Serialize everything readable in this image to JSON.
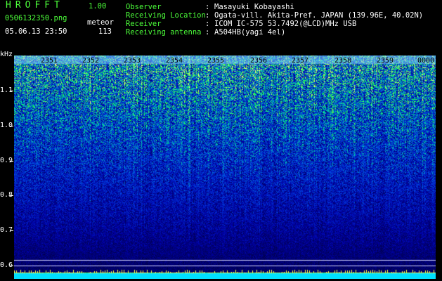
{
  "app": {
    "title": "HROFFT",
    "version": "1.00"
  },
  "file": {
    "name": "0506132350.png",
    "timestamp": "05.06.13 23:50"
  },
  "detection": {
    "label": "meteor",
    "count": "113"
  },
  "info": [
    {
      "key": "Observer",
      "value": "Masayuki Kobayashi"
    },
    {
      "key": "Receiving Location",
      "value": "Ogata-vill. Akita-Pref. JAPAN (139.96E, 40.02N)"
    },
    {
      "key": "Receiver",
      "value": "ICOM IC-575 53.7492(@LCD)MHz USB"
    },
    {
      "key": "Receiving antenna",
      "value": "A504HB(yagi 4el)"
    }
  ],
  "info_separator": ":",
  "spectrogram": {
    "unit": "kHz",
    "y_ticks": [
      "1.1",
      "1.0",
      "0.9",
      "0.8",
      "0.7",
      "0.6"
    ],
    "time_labels": [
      "2351",
      "2352",
      "2353",
      "2354",
      "2355",
      "2356",
      "2357",
      "2358",
      "2359",
      "0000"
    ]
  },
  "colors": {
    "label_green": "#4cff3a",
    "background": "#000000"
  }
}
